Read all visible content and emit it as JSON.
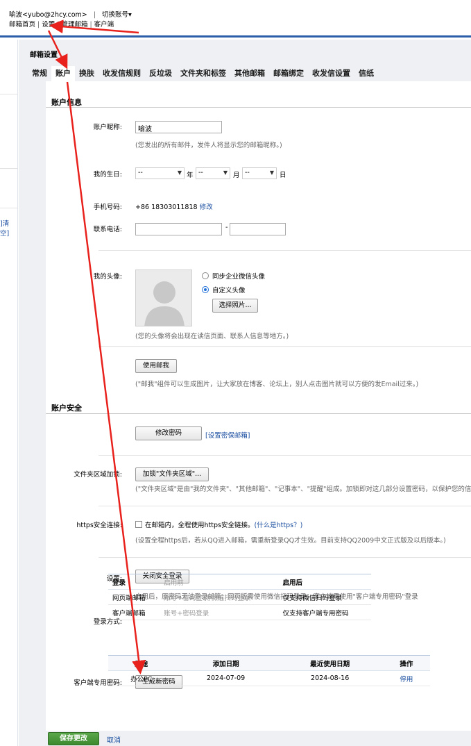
{
  "header": {
    "user": "喻波<yubo@2hcy.com>",
    "switch_account": "切换账号▾",
    "nav": [
      "邮箱首页",
      "设置",
      "管理邮箱",
      "客户端"
    ]
  },
  "left": {
    "clear_link": "]清空]"
  },
  "settings": {
    "title": "邮箱设置",
    "tabs": [
      "常规",
      "账户",
      "换肤",
      "收发信规则",
      "反垃圾",
      "文件夹和标签",
      "其他邮箱",
      "邮箱绑定",
      "收发信设置",
      "信纸"
    ],
    "active_tab": "账户"
  },
  "account_info": {
    "heading": "账户信息",
    "nickname_label": "账户昵称:",
    "nickname_value": "喻波",
    "nickname_hint": "(您发出的所有邮件，发件人将显示您的邮箱昵称。)",
    "birthday_label": "我的生日:",
    "year_placeholder": "--",
    "year_unit": "年",
    "month_placeholder": "--",
    "month_unit": "月",
    "day_placeholder": "--",
    "day_unit": "日",
    "mobile_label": "手机号码:",
    "mobile_value": "+86 18303011818",
    "mobile_modify": "修改",
    "phone_label": "联系电话:",
    "phone_sep": "-",
    "avatar_label": "我的头像:",
    "radio_sync": "同步企业微信头像",
    "radio_custom": "自定义头像",
    "choose_photo": "选择照片...",
    "avatar_hint": "(您的头像将会出现在读信页面、联系人信息等地方。)",
    "use_mailme": "使用邮我",
    "mailme_hint": "(\"邮我\"组件可以生成图片，让大家放在博客、论坛上，别人点击图片就可以方便的发Email过来。)"
  },
  "account_security": {
    "heading": "账户安全",
    "change_password": "修改密码",
    "security_email_link": "[设置密保邮箱]",
    "folder_lock_label": "文件夹区域加锁:",
    "folder_lock_button": "加锁\"文件夹区域\"...",
    "folder_lock_hint": "(\"文件夹区域\"是由\"我的文件夹\"、\"其他邮箱\"、\"记事本\"、\"提醒\"组成。加锁即对这几部分设置密码，以保护您的信息",
    "https_label": "https安全连接:",
    "https_checkbox": "在邮箱内，全程使用https安全链接。",
    "https_what": "(什么是https？)",
    "https_hint": "(设置全程https后，若从QQ进入邮箱，需重新登录QQ才生效。目前支持QQ2009中文正式版及以后版本。)",
    "setting_label": "设置:",
    "close_secure_login": "关闭安全登录",
    "secure_login_hint": "启用后，原密码无法登录邮箱；网页版需使用微信扫码登录；客户端需使用\"客户端专用密码\"登录",
    "login_method_label": "登录方式:",
    "login_table": {
      "headers": [
        "登录",
        "启用前",
        "启用后"
      ],
      "rows": [
        [
          "网页端邮箱",
          "账号+密码登录/微信扫码登录",
          "仅支持微信扫码登录"
        ],
        [
          "客户端邮箱",
          "账号+密码登录",
          "仅支持客户端专用密码"
        ]
      ]
    },
    "client_pwd_label": "客户端专用密码:",
    "generate_password": "生成新密码",
    "pwd_table": {
      "headers": [
        "用途",
        "添加日期",
        "最近使用日期",
        "操作"
      ],
      "rows": [
        [
          "办公PC",
          "2024-07-09",
          "2024-08-16",
          "停用"
        ]
      ]
    }
  },
  "footer": {
    "save": "保存更改",
    "cancel": "取消"
  },
  "colors": {
    "accent_blue": "#2b5ea8",
    "link": "#1a4ea0",
    "save_green": "#4a9a3c",
    "arrow_red": "#e8211c"
  }
}
